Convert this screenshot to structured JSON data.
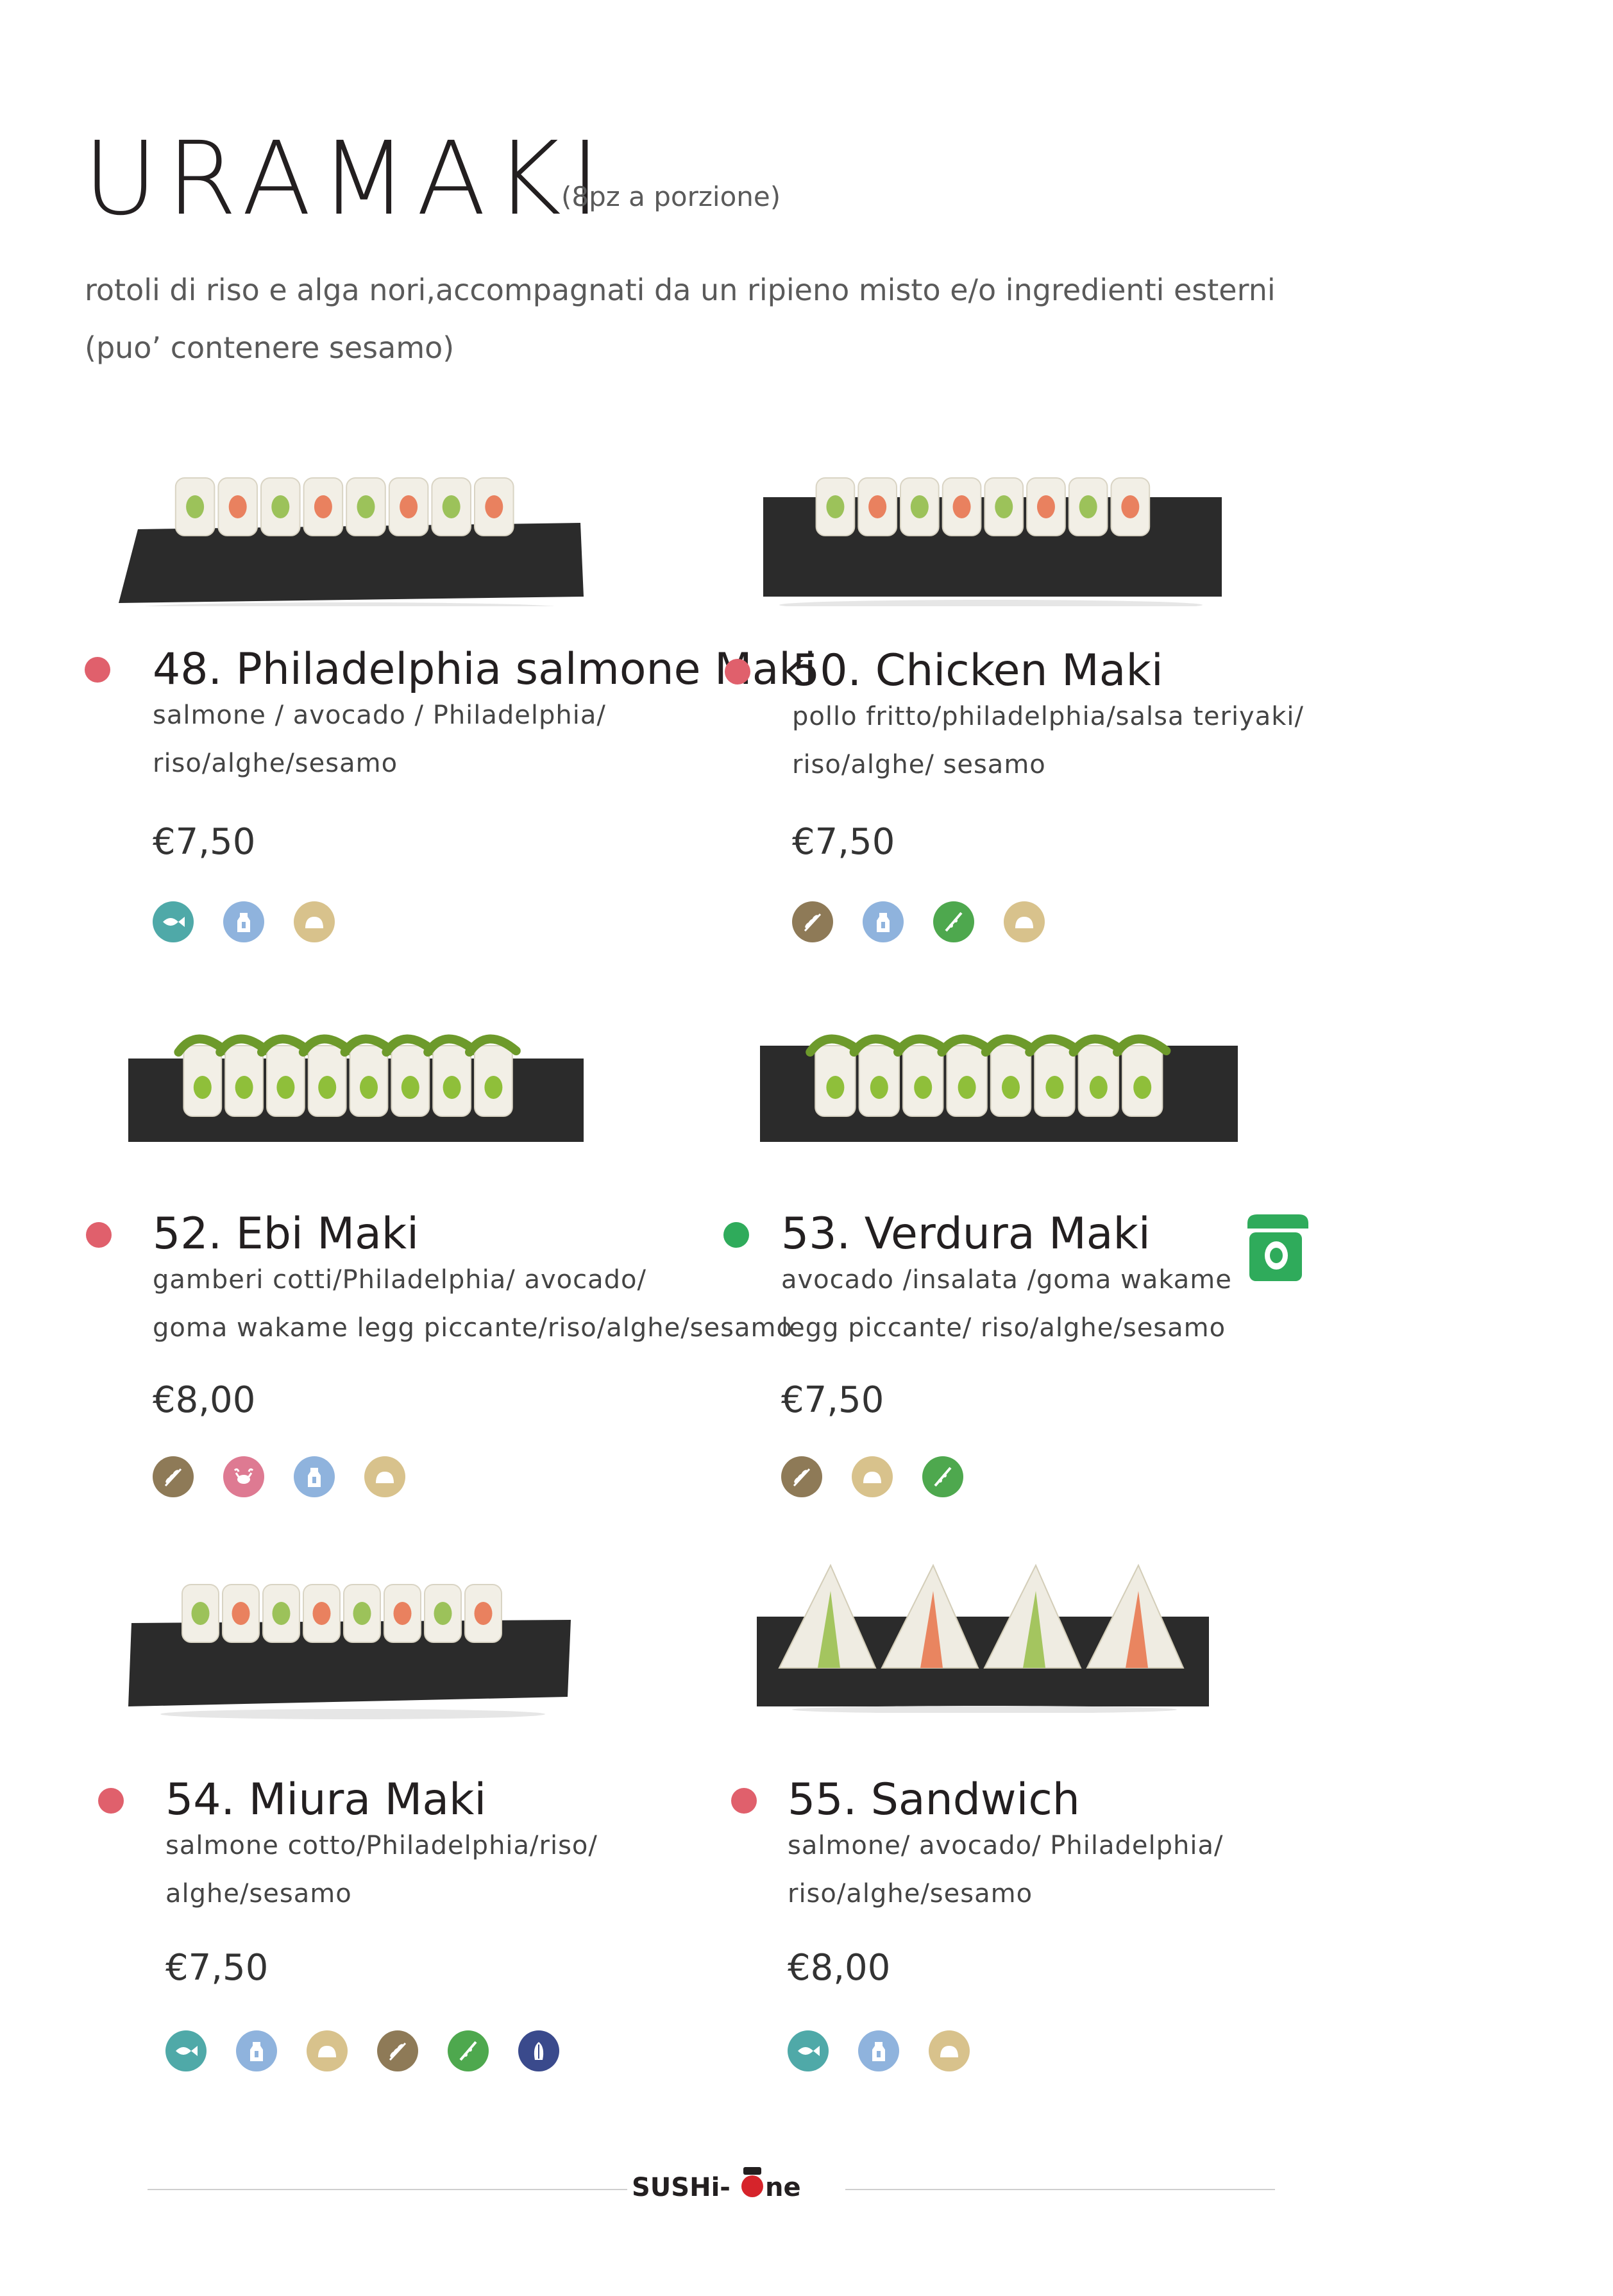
{
  "header": {
    "title": "URAMAKI",
    "portion": "(8pz a porzione)",
    "intro_line1": "rotoli di riso e alga nori,accompagnati da un ripieno misto e/o ingredienti esterni",
    "intro_line2": "(puo’ contenere sesamo)"
  },
  "items": [
    {
      "name": "48. Philadelphia salmone Maki",
      "desc1": "salmone / avocado / Philadelphia/",
      "desc2": "riso/alghe/sesamo",
      "price": "€7,50",
      "dot_color": "#e0606c",
      "allergens": [
        "fish-icon",
        "milk-icon",
        "sesame-icon"
      ]
    },
    {
      "name": "50. Chicken Maki",
      "desc1": "pollo fritto/philadelphia/salsa teriyaki/",
      "desc2": "riso/alghe/ sesamo",
      "price": "€7,50",
      "dot_color": "#e0606c",
      "allergens": [
        "gluten-icon",
        "milk-icon",
        "soy-icon",
        "sesame-icon"
      ]
    },
    {
      "name": "52. Ebi Maki",
      "desc1": "gamberi cotti/Philadelphia/ avocado/",
      "desc2": "goma wakame legg piccante/riso/alghe/sesamo",
      "price": "€8,00",
      "dot_color": "#e0606c",
      "allergens": [
        "gluten-icon",
        "crustacean-icon",
        "milk-icon",
        "sesame-icon"
      ]
    },
    {
      "name": "53. Verdura Maki",
      "desc1": "avocado /insalata /goma wakame",
      "desc2": "legg piccante/ riso/alghe/sesamo",
      "price": "€7,50",
      "dot_color": "#2fab5b",
      "allergens": [
        "gluten-icon",
        "sesame-icon",
        "soy-icon"
      ]
    },
    {
      "name": "54. Miura Maki",
      "desc1": "salmone cotto/Philadelphia/riso/",
      "desc2": "alghe/sesamo",
      "price": "€7,50",
      "dot_color": "#e0606c",
      "allergens": [
        "fish-icon",
        "milk-icon",
        "sesame-icon",
        "gluten-icon",
        "soy-icon",
        "mollusc-icon"
      ]
    },
    {
      "name": "55. Sandwich",
      "desc1": "salmone/ avocado/ Philadelphia/",
      "desc2": "riso/alghe/sesamo",
      "price": "€8,00",
      "dot_color": "#e0606c",
      "allergens": [
        "fish-icon",
        "milk-icon",
        "sesame-icon"
      ]
    }
  ],
  "colors": {
    "fish": "#4fa9a8",
    "milk": "#8fb3dd",
    "sesame": "#d8c28c",
    "gluten": "#8e7a57",
    "soy": "#4ea84e",
    "crustacean": "#de7a92",
    "mollusc": "#3a4a8c",
    "vegetarian": "#2fab5b"
  },
  "vegetarian_badge": "vegetarian-jar-icon",
  "footer": {
    "logo_left": "SUSHi-",
    "logo_right": "ne"
  }
}
